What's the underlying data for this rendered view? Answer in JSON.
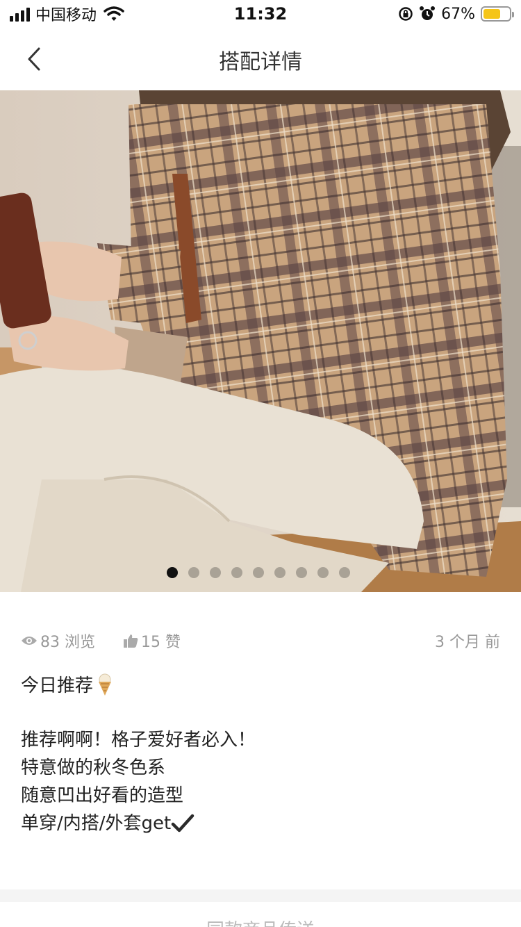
{
  "status_bar": {
    "carrier": "中国移动",
    "time": "11:32",
    "battery_percent": "67%",
    "battery_level": 0.67,
    "battery_color": "#f5c518"
  },
  "nav": {
    "title": "搭配详情",
    "back_icon": "chevron-left-icon"
  },
  "carousel": {
    "current_index": 1,
    "total": 9
  },
  "stats": {
    "views": "83 浏览",
    "likes": "15 赞",
    "time_ago": "3 个月 前"
  },
  "post": {
    "title": "今日推荐",
    "title_icon": "ice-cream-icon",
    "lines": [
      "推荐啊啊！格子爱好者必入！",
      "特意做的秋冬色系",
      "随意凹出好看的造型",
      "单穿/内搭/外套get"
    ],
    "last_line_icon": "checkmark-icon"
  },
  "section": {
    "title": "同款商品传送"
  },
  "colors": {
    "accent_text": "#222222",
    "muted": "#999999",
    "plaid_base": "#c4a07a",
    "plaid_dark": "#4a3838",
    "pants": "#e8dfd0"
  }
}
